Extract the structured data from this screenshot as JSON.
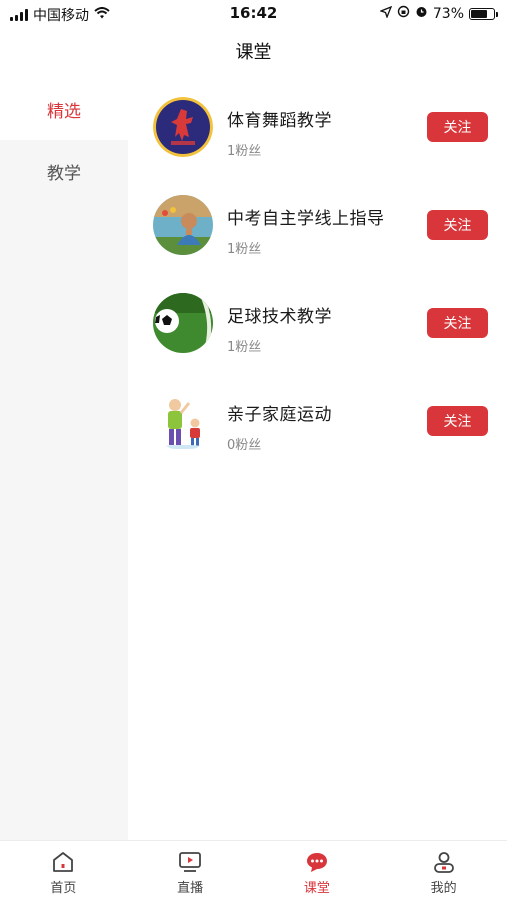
{
  "status_bar": {
    "carrier": "中国移动",
    "time": "16:42",
    "battery": "73%",
    "battery_level": 0.73
  },
  "header": {
    "title": "课堂"
  },
  "sidebar": {
    "items": [
      {
        "label": "精选",
        "active": true
      },
      {
        "label": "教学",
        "active": false
      }
    ]
  },
  "courses": [
    {
      "title": "体育舞蹈教学",
      "fans": "1粉丝",
      "follow_label": "关注",
      "avatar_icon": "dance-logo-avatar"
    },
    {
      "title": "中考自主学线上指导",
      "fans": "1粉丝",
      "follow_label": "关注",
      "avatar_icon": "teacher-photo-avatar"
    },
    {
      "title": "足球技术教学",
      "fans": "1粉丝",
      "follow_label": "关注",
      "avatar_icon": "soccer-ball-avatar"
    },
    {
      "title": "亲子家庭运动",
      "fans": "0粉丝",
      "follow_label": "关注",
      "avatar_icon": "parent-child-avatar"
    }
  ],
  "tabbar": {
    "items": [
      {
        "label": "首页",
        "icon": "home-icon",
        "active": false
      },
      {
        "label": "直播",
        "icon": "live-tv-icon",
        "active": false
      },
      {
        "label": "课堂",
        "icon": "classroom-chat-icon",
        "active": true
      },
      {
        "label": "我的",
        "icon": "profile-icon",
        "active": false
      }
    ]
  },
  "colors": {
    "accent": "#d8363a",
    "sidebar_bg": "#f5f6f5",
    "text_muted": "#888888"
  }
}
